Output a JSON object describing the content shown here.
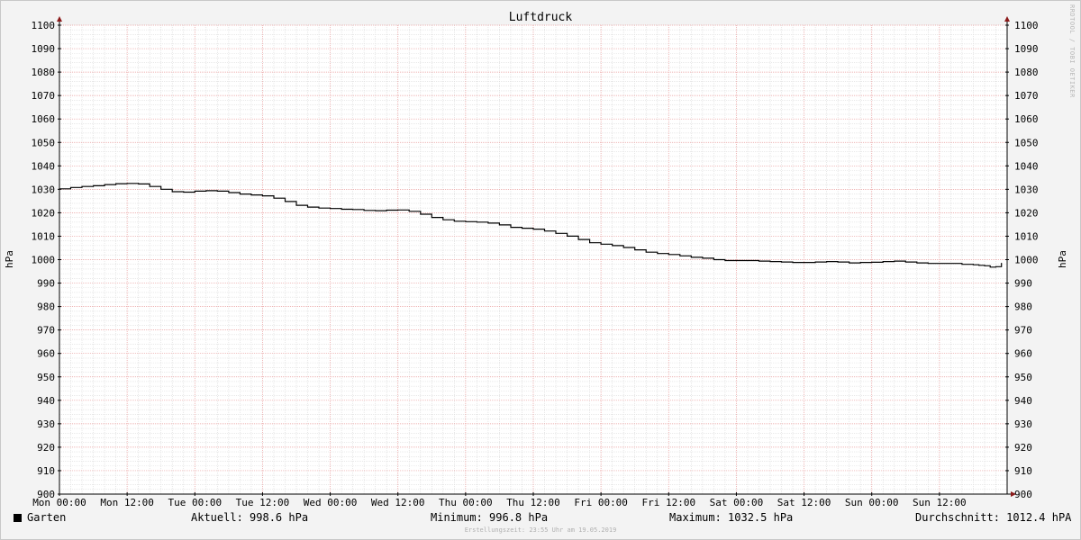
{
  "chart_data": {
    "type": "line",
    "title": "Luftdruck",
    "ylabel": "hPa",
    "ylabel_right": "hPa",
    "ylim": [
      900,
      1100
    ],
    "yticks": [
      900,
      910,
      920,
      930,
      940,
      950,
      960,
      970,
      980,
      990,
      1000,
      1010,
      1020,
      1030,
      1040,
      1050,
      1060,
      1070,
      1080,
      1090,
      1100
    ],
    "xlim_hours": [
      0,
      168
    ],
    "xticks": [
      {
        "h": 0,
        "label": "Mon 00:00"
      },
      {
        "h": 12,
        "label": "Mon 12:00"
      },
      {
        "h": 24,
        "label": "Tue 00:00"
      },
      {
        "h": 36,
        "label": "Tue 12:00"
      },
      {
        "h": 48,
        "label": "Wed 00:00"
      },
      {
        "h": 60,
        "label": "Wed 12:00"
      },
      {
        "h": 72,
        "label": "Thu 00:00"
      },
      {
        "h": 84,
        "label": "Thu 12:00"
      },
      {
        "h": 96,
        "label": "Fri 00:00"
      },
      {
        "h": 108,
        "label": "Fri 12:00"
      },
      {
        "h": 120,
        "label": "Sat 00:00"
      },
      {
        "h": 132,
        "label": "Sat 12:00"
      },
      {
        "h": 144,
        "label": "Sun 00:00"
      },
      {
        "h": 156,
        "label": "Sun 12:00"
      }
    ],
    "grid": true,
    "series": [
      {
        "name": "Garten",
        "color": "#000000",
        "x_hours": [
          0,
          2,
          4,
          6,
          8,
          10,
          12,
          14,
          16,
          18,
          20,
          22,
          24,
          26,
          28,
          30,
          32,
          34,
          36,
          38,
          40,
          42,
          44,
          46,
          48,
          50,
          52,
          54,
          56,
          58,
          60,
          62,
          64,
          66,
          68,
          70,
          72,
          74,
          76,
          78,
          80,
          82,
          84,
          86,
          88,
          90,
          92,
          94,
          96,
          98,
          100,
          102,
          104,
          106,
          108,
          110,
          112,
          114,
          116,
          118,
          120,
          122,
          124,
          126,
          128,
          130,
          132,
          134,
          136,
          138,
          140,
          142,
          144,
          146,
          148,
          150,
          152,
          154,
          156,
          158,
          160,
          162,
          163,
          164,
          165,
          166,
          167
        ],
        "values": [
          1030.2,
          1030.8,
          1031.2,
          1031.5,
          1032.0,
          1032.4,
          1032.5,
          1032.3,
          1031.2,
          1030.0,
          1029.0,
          1028.8,
          1029.2,
          1029.4,
          1029.2,
          1028.6,
          1028.0,
          1027.6,
          1027.2,
          1026.2,
          1024.8,
          1023.2,
          1022.4,
          1022.0,
          1021.8,
          1021.5,
          1021.4,
          1021.0,
          1020.9,
          1021.1,
          1021.2,
          1020.6,
          1019.4,
          1018.0,
          1017.0,
          1016.4,
          1016.2,
          1016.0,
          1015.6,
          1014.8,
          1013.8,
          1013.4,
          1013.0,
          1012.2,
          1011.2,
          1010.0,
          1008.6,
          1007.2,
          1006.6,
          1006.0,
          1005.2,
          1004.2,
          1003.2,
          1002.6,
          1002.2,
          1001.6,
          1001.0,
          1000.6,
          1000.0,
          999.6,
          999.6,
          999.6,
          999.4,
          999.2,
          999.0,
          998.8,
          998.8,
          999.0,
          999.2,
          999.0,
          998.6,
          998.8,
          998.9,
          999.2,
          999.4,
          999.0,
          998.6,
          998.4,
          998.4,
          998.4,
          998.0,
          997.8,
          997.6,
          997.4,
          996.8,
          997.0,
          998.6
        ]
      }
    ]
  },
  "legend": {
    "series_name": "Garten",
    "current": "Aktuell: 998.6 hPa",
    "minimum": "Minimum: 996.8 hPa",
    "maximum": "Maximum: 1032.5 hPa",
    "average": "Durchschnitt: 1012.4 hPA"
  },
  "footer": "Erstellungszeit: 23:55 Uhr am 19.05.2019",
  "watermark": "RRDTOOL / TOBI OETIKER"
}
